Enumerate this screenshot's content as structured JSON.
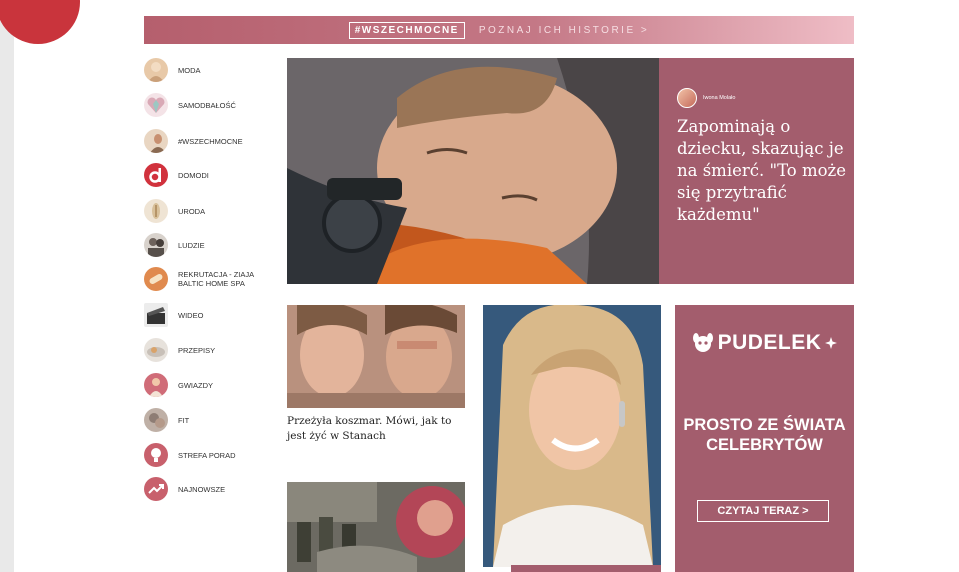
{
  "banner": {
    "tag": "#WSZECHMOCNE",
    "link": "POZNAJ ICH HISTORIE >"
  },
  "sidebar": {
    "items": [
      {
        "label": "MODA",
        "icon": "fashion-icon",
        "color": "#e8c9a8"
      },
      {
        "label": "SAMODBAŁOŚĆ",
        "icon": "heart-icon",
        "color": "#d9a9b6"
      },
      {
        "label": "#WSZECHMOCNE",
        "icon": "woman-photo-icon",
        "color": "#d9b28a"
      },
      {
        "label": "DOMODI",
        "icon": "domodi-logo-icon",
        "color": "#d1323d"
      },
      {
        "label": "URODA",
        "icon": "beauty-icon",
        "color": "#d8c09a"
      },
      {
        "label": "LUDZIE",
        "icon": "people-icon",
        "color": "#6d625b"
      },
      {
        "label": "REKRUTACJA - ZIAJA BALTIC HOME SPA",
        "icon": "spa-icon",
        "color": "#e08a4e"
      },
      {
        "label": "WIDEO",
        "icon": "clapperboard-icon",
        "color": "#444444"
      },
      {
        "label": "PRZEPISY",
        "icon": "food-icon",
        "color": "#c8c0b8"
      },
      {
        "label": "GWIAZDY",
        "icon": "star-photo-icon",
        "color": "#d06c78"
      },
      {
        "label": "FIT",
        "icon": "fitness-icon",
        "color": "#8e7d74"
      },
      {
        "label": "STREFA PORAD",
        "icon": "lightbulb-icon",
        "color": "#c8606c"
      },
      {
        "label": "NAJNOWSZE",
        "icon": "trending-icon",
        "color": "#c8606c"
      }
    ]
  },
  "main_article": {
    "author": "Iwona Molało",
    "headline": "Zapominają o dziecku, skazując je na śmierć. \"To może się przytrafić każdemu\""
  },
  "card1": {
    "title": "Przeżyła koszmar. Mówi, jak to jest żyć w Stanach"
  },
  "promo": {
    "logo": "PUDELEK",
    "headline": "PROSTO ZE ŚWIATA CELEBRYTÓW",
    "button": "CZYTAJ TERAZ >"
  },
  "colors": {
    "accent": "#a35d6d",
    "brand_red": "#c9343c"
  }
}
